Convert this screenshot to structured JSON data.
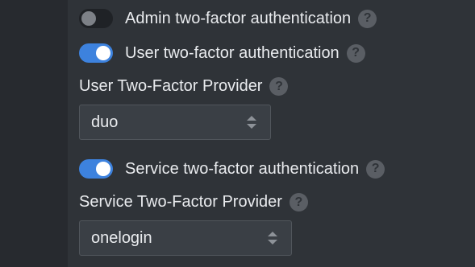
{
  "admin_2fa": {
    "label": "Admin two-factor authentication",
    "enabled": false
  },
  "user_2fa": {
    "label": "User two-factor authentication",
    "enabled": true
  },
  "user_provider": {
    "label": "User Two-Factor Provider",
    "value": "duo"
  },
  "service_2fa": {
    "label": "Service two-factor authentication",
    "enabled": true
  },
  "service_provider": {
    "label": "Service Two-Factor Provider",
    "value": "onelogin"
  },
  "help_glyph": "?",
  "colors": {
    "toggle_on": "#3d82de",
    "toggle_off": "#1f2226",
    "background": "#2f3338"
  }
}
